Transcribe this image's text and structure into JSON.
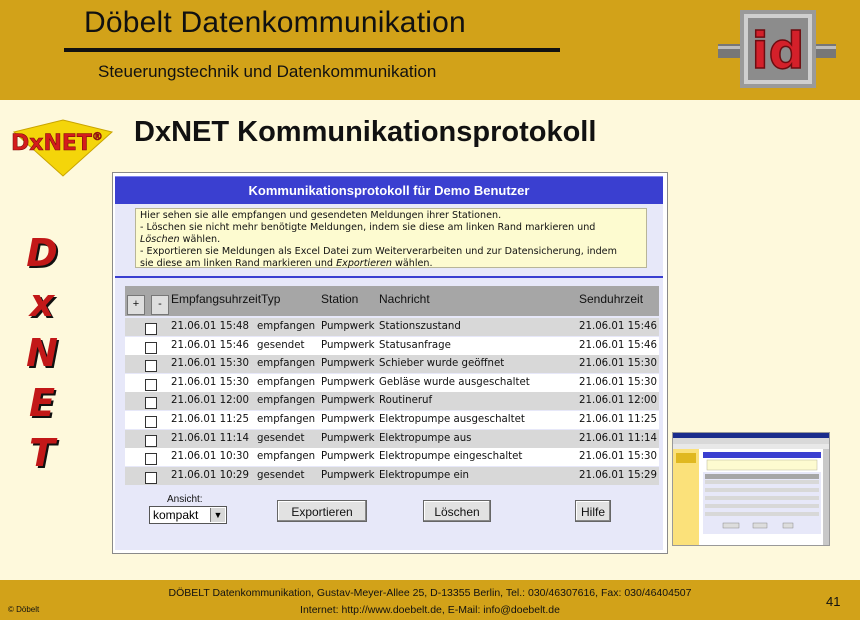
{
  "header": {
    "title": "Döbelt Datenkommunikation",
    "subtitle": "Steuerungstechnik und Datenkommunikation",
    "logo_text": "id"
  },
  "badge": {
    "text": "DxNET",
    "reg": "®"
  },
  "slide_title": "DxNET Kommunikationsprotokoll",
  "vertical_letters": [
    "D",
    "x",
    "N",
    "E",
    "T"
  ],
  "window": {
    "title": "Kommunikationsprotokoll für Demo Benutzer",
    "info": {
      "line1": "Hier sehen sie alle empfangen und gesendeten Meldungen ihrer Stationen.",
      "line2": "- Löschen sie nicht mehr benötigte Meldungen, indem sie diese am linken Rand markieren und",
      "line3_em": "Löschen",
      "line3_rest": " wählen.",
      "line4": "- Exportieren sie Meldungen als Excel Datei zum Weiterverarbeiten und zur Datensicherung, indem",
      "line5_pre": "sie diese am linken Rand markieren und ",
      "line5_em": "Exportieren",
      "line5_rest": " wählen."
    },
    "table": {
      "plus": "+",
      "minus": "-",
      "columns": [
        "EmpfangsuhrzeitTyp",
        "Station",
        "Nachricht",
        "Senduhrzeit"
      ],
      "rows": [
        {
          "empf": "21.06.01 15:48",
          "typ": "empfangen",
          "station": "Pumpwerk",
          "nachricht": "Stationszustand",
          "send": "21.06.01 15:46"
        },
        {
          "empf": "21.06.01 15:46",
          "typ": "gesendet",
          "station": "Pumpwerk",
          "nachricht": "Statusanfrage",
          "send": "21.06.01 15:46"
        },
        {
          "empf": "21.06.01 15:30",
          "typ": "empfangen",
          "station": "Pumpwerk",
          "nachricht": "Schieber wurde geöffnet",
          "send": "21.06.01 15:30"
        },
        {
          "empf": "21.06.01 15:30",
          "typ": "empfangen",
          "station": "Pumpwerk",
          "nachricht": "Gebläse wurde ausgeschaltet",
          "send": "21.06.01 15:30"
        },
        {
          "empf": "21.06.01 12:00",
          "typ": "empfangen",
          "station": "Pumpwerk",
          "nachricht": "Routineruf",
          "send": "21.06.01 12:00"
        },
        {
          "empf": "21.06.01 11:25",
          "typ": "empfangen",
          "station": "Pumpwerk",
          "nachricht": "Elektropumpe ausgeschaltet",
          "send": "21.06.01 11:25"
        },
        {
          "empf": "21.06.01 11:14",
          "typ": "gesendet",
          "station": "Pumpwerk",
          "nachricht": "Elektropumpe aus",
          "send": "21.06.01 11:14"
        },
        {
          "empf": "21.06.01 10:30",
          "typ": "empfangen",
          "station": "Pumpwerk",
          "nachricht": "Elektropumpe eingeschaltet",
          "send": "21.06.01 15:30"
        },
        {
          "empf": "21.06.01 10:29",
          "typ": "gesendet",
          "station": "Pumpwerk",
          "nachricht": "Elektropumpe ein",
          "send": "21.06.01 15:29"
        }
      ]
    },
    "view_label": "Ansicht:",
    "view_value": "kompakt",
    "buttons": {
      "export": "Exportieren",
      "delete": "Löschen",
      "help": "Hilfe"
    }
  },
  "footer": {
    "line1": "DÖBELT Datenkommunikation, Gustav-Meyer-Allee 25, D-13355 Berlin, Tel.: 030/46307616, Fax: 030/46404507",
    "line2": "Internet: http://www.doebelt.de, E-Mail: info@doebelt.de",
    "copyright": "© Döbelt",
    "page": "41"
  },
  "colors": {
    "band": "#d2a219",
    "background": "#fef9dc",
    "window_title": "#3a3fd0",
    "accent_red": "#c21818"
  }
}
